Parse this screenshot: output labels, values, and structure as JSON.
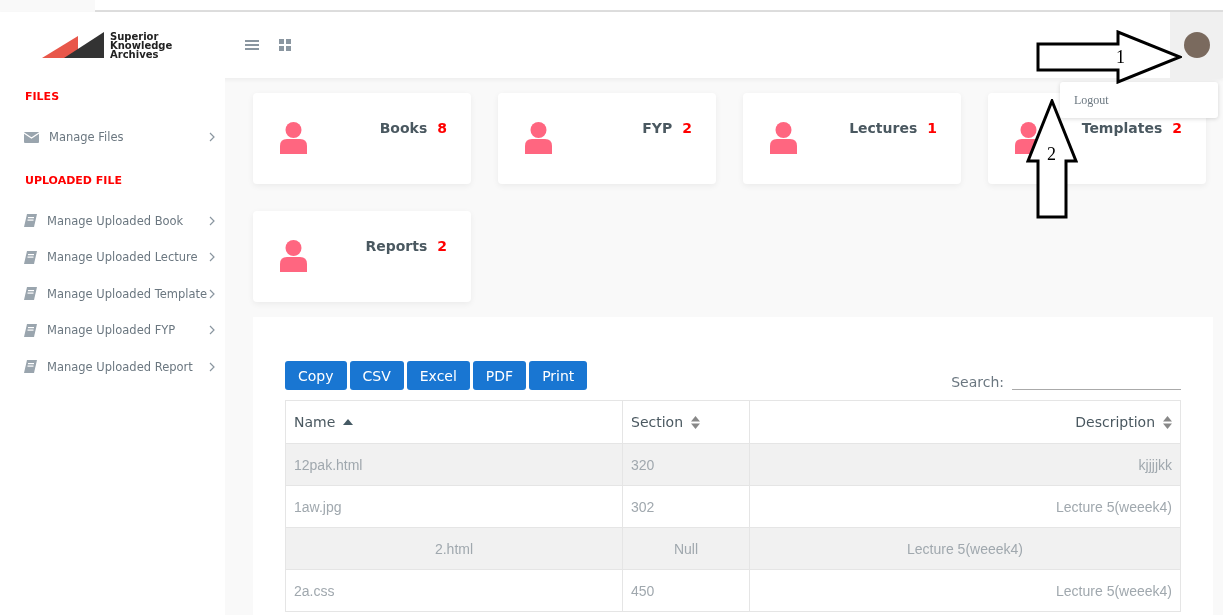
{
  "brand": {
    "name_lines": [
      "Superior",
      "Knowledge",
      "Archives"
    ]
  },
  "user_menu": {
    "items": [
      "Logout"
    ]
  },
  "annotations": [
    {
      "kind": "right-arrow",
      "label": "1"
    },
    {
      "kind": "up-arrow",
      "label": "2"
    }
  ],
  "sidebar": {
    "sections": [
      {
        "title": "FILES",
        "items": [
          {
            "label": "Manage Files",
            "kind": "mail"
          }
        ]
      },
      {
        "title": "UPLOADED FILE",
        "items": [
          {
            "label": "Manage Uploaded Book",
            "kind": "book"
          },
          {
            "label": "Manage Uploaded Lecture",
            "kind": "book"
          },
          {
            "label": "Manage Uploaded Template",
            "kind": "book"
          },
          {
            "label": "Manage Uploaded FYP",
            "kind": "book"
          },
          {
            "label": "Manage Uploaded Report",
            "kind": "book"
          }
        ]
      }
    ]
  },
  "stat_cards": [
    {
      "label": "Books",
      "count": "8"
    },
    {
      "label": "FYP",
      "count": "2"
    },
    {
      "label": "Lectures",
      "count": "1"
    },
    {
      "label": "Templates",
      "count": "2"
    },
    {
      "label": "Reports",
      "count": "2"
    }
  ],
  "export_buttons": [
    "Copy",
    "CSV",
    "Excel",
    "PDF",
    "Print"
  ],
  "search": {
    "label": "Search:"
  },
  "table": {
    "columns": [
      {
        "label": "Name",
        "sorted": true
      },
      {
        "label": "Section",
        "sorted": false
      },
      {
        "label": "Description",
        "sorted": false
      }
    ],
    "rows": [
      {
        "cells": [
          "12pak.html",
          "320",
          "kjjjjkk"
        ],
        "centered": false
      },
      {
        "cells": [
          "1aw.jpg",
          "302",
          "Lecture 5(weeek4)"
        ],
        "centered": false
      },
      {
        "cells": [
          "2.html",
          "Null",
          "Lecture 5(weeek4)"
        ],
        "centered": true
      },
      {
        "cells": [
          "2a.css",
          "450",
          "Lecture 5(weeek4)"
        ],
        "centered": false
      }
    ]
  }
}
